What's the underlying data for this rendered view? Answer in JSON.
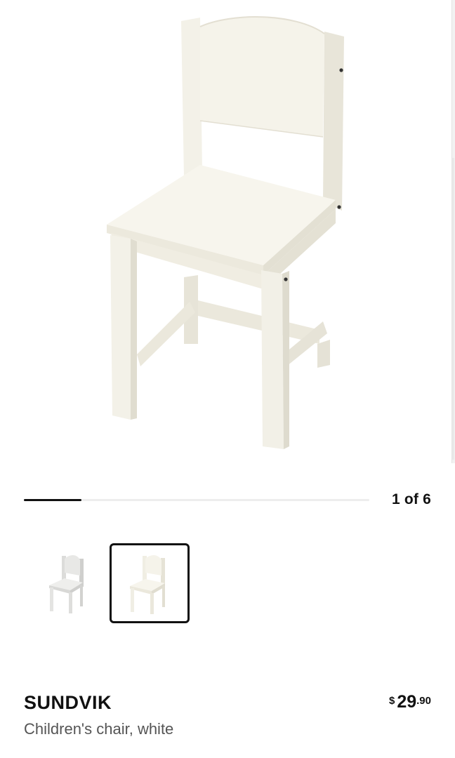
{
  "gallery": {
    "main_image_alt": "chair-image",
    "counter": "1 of 6",
    "progress": 0.167,
    "thumbnails": [
      {
        "color": "grey-white",
        "selected": false
      },
      {
        "color": "white",
        "selected": true
      }
    ]
  },
  "product": {
    "name": "SUNDVIK",
    "description": "Children's chair, white",
    "price": {
      "currency": "$",
      "integer": "29",
      "decimal": ".90"
    }
  },
  "colors": {
    "text": "#111111",
    "muted": "#555555",
    "chair_white": "#f5f3ea",
    "chair_grey": "#e4e4e2"
  }
}
